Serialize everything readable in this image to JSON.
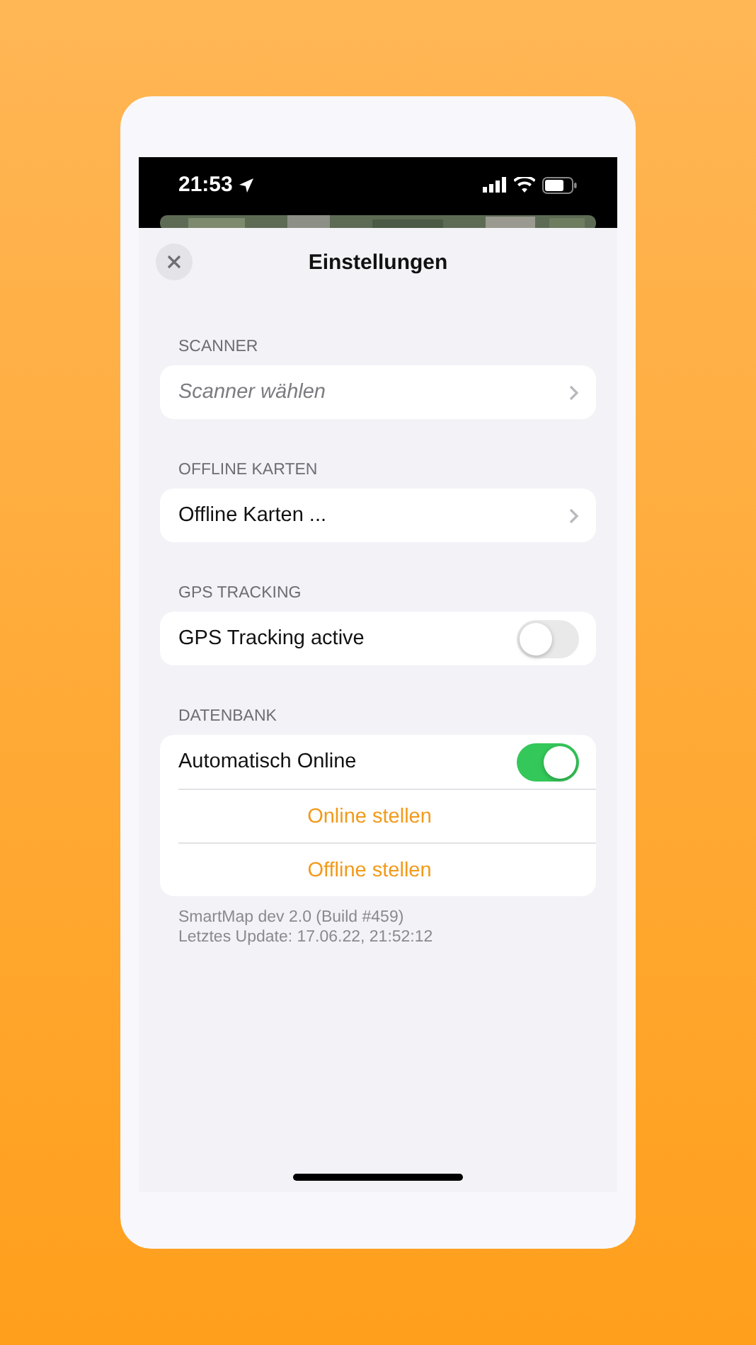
{
  "status_bar": {
    "time": "21:53"
  },
  "sheet": {
    "title": "Einstellungen"
  },
  "sections": [
    {
      "header": "SCANNER",
      "rows": [
        {
          "kind": "picker",
          "placeholder": "Scanner wählen"
        }
      ]
    },
    {
      "header": "OFFLINE KARTEN",
      "rows": [
        {
          "kind": "link",
          "label": "Offline Karten ..."
        }
      ]
    },
    {
      "header": "GPS TRACKING",
      "rows": [
        {
          "kind": "toggle",
          "label": "GPS Tracking active",
          "on": false
        }
      ]
    },
    {
      "header": "DATENBANK",
      "rows": [
        {
          "kind": "toggle",
          "label": "Automatisch Online",
          "on": true
        },
        {
          "kind": "action",
          "label": "Online stellen"
        },
        {
          "kind": "action",
          "label": "Offline stellen"
        }
      ]
    }
  ],
  "footer": [
    "SmartMap dev  2.0 (Build #459)",
    "Letztes Update: 17.06.22, 21:52:12"
  ]
}
